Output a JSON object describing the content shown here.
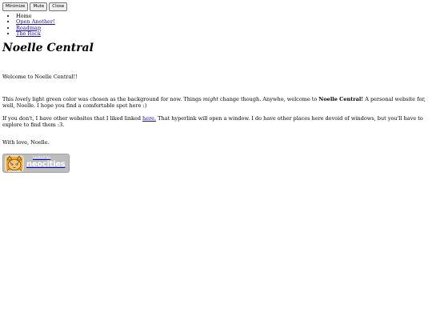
{
  "window_controls": {
    "minimize": "Minimize",
    "mute": "Mute",
    "close": "Close"
  },
  "nav": {
    "items": [
      {
        "label": "Home"
      },
      {
        "label": "Open Another!"
      },
      {
        "label": "Roadmap"
      },
      {
        "label": "The Rock"
      }
    ]
  },
  "page_title": "Noelle Central",
  "welcome": "Welcome to Noelle Central!!",
  "para1": {
    "t1": "This ",
    "em1": "lovely",
    "t2": " light green color was chosen as the background for now. Things ",
    "em2": "might",
    "t3": " change though. Anywho, welcome to ",
    "strong": "Noelle Central!",
    "t4": " A personal website for, well, Noelle. I hope you find a comfortable spot here :)"
  },
  "para2": {
    "t1": "If you don't, I have other websites that I liked linked ",
    "link": "here.",
    "t2": " That hyperlink will open a window. I do have other places here devoid of windows, but you'll have to explore to find them :3."
  },
  "signoff": "With love, Noelle.",
  "badge": {
    "small": "hosted by",
    "big": "neocities",
    "icon": "neocities-cat-icon"
  }
}
